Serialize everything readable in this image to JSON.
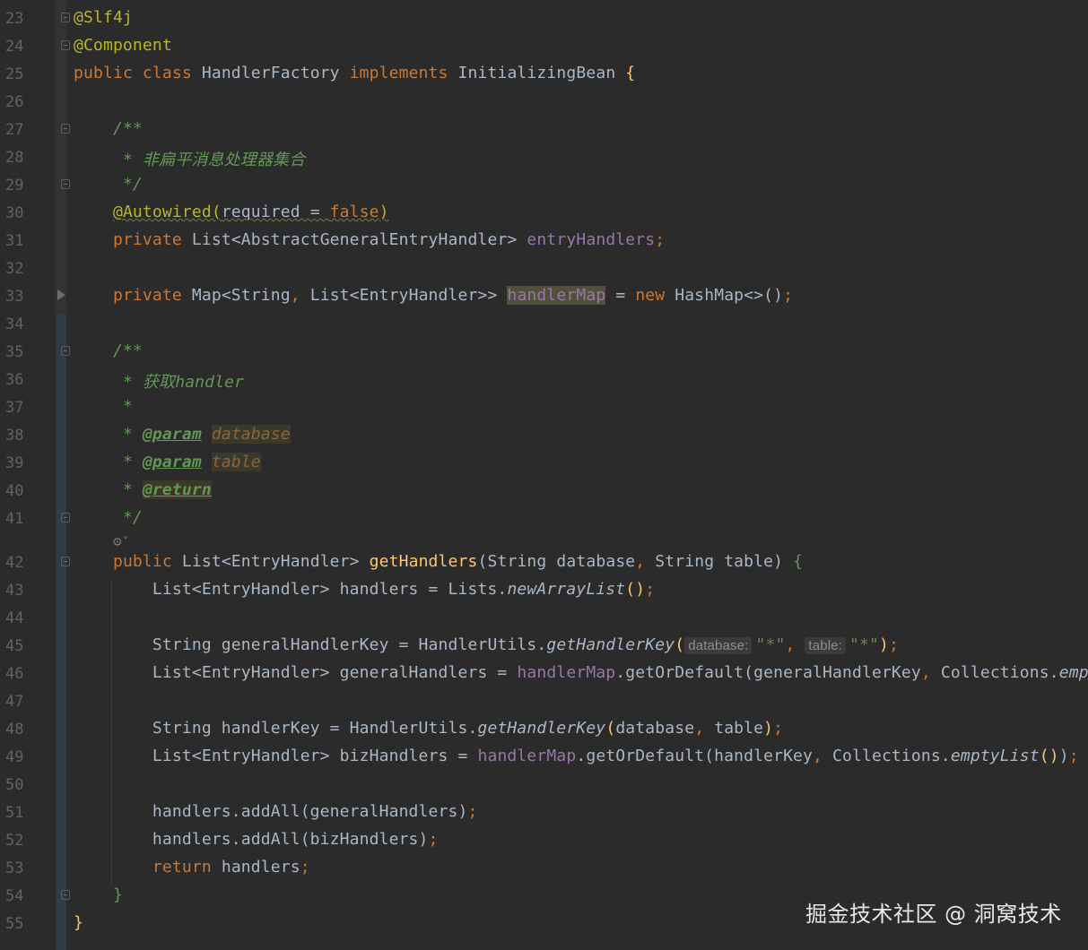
{
  "editor": {
    "language": "Java",
    "colors": {
      "background": "#2b2b2b",
      "keyword": "#cc7832",
      "annotation": "#bbb529",
      "field": "#9876aa",
      "method": "#ffc66d",
      "comment": "#629755",
      "string": "#6a8759",
      "default": "#a9b7c6",
      "line_number": "#606366"
    },
    "lines": [
      {
        "n": "23",
        "tokens": [
          {
            "c": "ann",
            "t": "@Slf4j"
          }
        ]
      },
      {
        "n": "24",
        "tokens": [
          {
            "c": "ann",
            "t": "@Component"
          }
        ]
      },
      {
        "n": "25",
        "tokens": [
          {
            "c": "kw",
            "t": "public class "
          },
          {
            "c": "plain",
            "t": "HandlerFactory "
          },
          {
            "c": "kw",
            "t": "implements "
          },
          {
            "c": "plain",
            "t": "InitializingBean "
          },
          {
            "c": "fn",
            "t": "{"
          }
        ]
      },
      {
        "n": "26",
        "tokens": []
      },
      {
        "n": "27",
        "tokens": [
          {
            "c": "plain",
            "t": "    "
          },
          {
            "c": "cm",
            "t": "/**"
          }
        ]
      },
      {
        "n": "28",
        "tokens": [
          {
            "c": "plain",
            "t": "     "
          },
          {
            "c": "cm",
            "t": "* 非扁平消息处理器集合"
          }
        ]
      },
      {
        "n": "29",
        "tokens": [
          {
            "c": "plain",
            "t": "     "
          },
          {
            "c": "cm",
            "t": "*/"
          }
        ]
      },
      {
        "n": "30",
        "tokens": [
          {
            "c": "plain",
            "t": "    "
          },
          {
            "c": "ann squig",
            "t": "@Autowired("
          },
          {
            "c": "plain squig",
            "t": "required = "
          },
          {
            "c": "kw squig",
            "t": "false"
          },
          {
            "c": "ann squig",
            "t": ")"
          }
        ]
      },
      {
        "n": "31",
        "tokens": [
          {
            "c": "plain",
            "t": "    "
          },
          {
            "c": "kw",
            "t": "private "
          },
          {
            "c": "plain",
            "t": "List<AbstractGeneralEntryHandler> "
          },
          {
            "c": "fld",
            "t": "entryHandlers"
          },
          {
            "c": "kw",
            "t": ";"
          }
        ]
      },
      {
        "n": "32",
        "tokens": []
      },
      {
        "n": "33",
        "tokens": [
          {
            "c": "plain",
            "t": "    "
          },
          {
            "c": "kw",
            "t": "private "
          },
          {
            "c": "plain",
            "t": "Map<String"
          },
          {
            "c": "kw",
            "t": ", "
          },
          {
            "c": "plain",
            "t": "List<EntryHandler>> "
          },
          {
            "c": "fld hl-field",
            "t": "handlerMap"
          },
          {
            "c": "plain",
            "t": " = "
          },
          {
            "c": "kw",
            "t": "new "
          },
          {
            "c": "plain",
            "t": "HashMap<>()"
          },
          {
            "c": "kw",
            "t": ";"
          }
        ]
      },
      {
        "n": "34",
        "tokens": []
      },
      {
        "n": "35",
        "tokens": [
          {
            "c": "plain",
            "t": "    "
          },
          {
            "c": "cm",
            "t": "/**"
          }
        ]
      },
      {
        "n": "36",
        "tokens": [
          {
            "c": "plain",
            "t": "     "
          },
          {
            "c": "cm",
            "t": "* 获取handler"
          }
        ]
      },
      {
        "n": "37",
        "tokens": [
          {
            "c": "plain",
            "t": "     "
          },
          {
            "c": "cm",
            "t": "*"
          }
        ]
      },
      {
        "n": "38",
        "tokens": [
          {
            "c": "plain",
            "t": "     "
          },
          {
            "c": "cm",
            "t": "* "
          },
          {
            "c": "tag",
            "t": "@param"
          },
          {
            "c": "plain",
            "t": " "
          },
          {
            "c": "tagarg hl-param",
            "t": "database"
          }
        ]
      },
      {
        "n": "39",
        "tokens": [
          {
            "c": "plain",
            "t": "     "
          },
          {
            "c": "cm",
            "t": "* "
          },
          {
            "c": "tag",
            "t": "@param"
          },
          {
            "c": "plain",
            "t": " "
          },
          {
            "c": "tagarg hl-param",
            "t": "table"
          }
        ]
      },
      {
        "n": "40",
        "tokens": [
          {
            "c": "plain",
            "t": "     "
          },
          {
            "c": "cm",
            "t": "* "
          },
          {
            "c": "tag hl-param",
            "t": "@return"
          }
        ]
      },
      {
        "n": "41",
        "tokens": [
          {
            "c": "plain",
            "t": "     "
          },
          {
            "c": "cm",
            "t": "*/"
          }
        ]
      },
      {
        "n": "42",
        "tokens": [
          {
            "c": "plain",
            "t": "    "
          },
          {
            "c": "kw",
            "t": "public "
          },
          {
            "c": "plain",
            "t": "List<EntryHandler> "
          },
          {
            "c": "fn",
            "t": "getHandlers"
          },
          {
            "c": "plain",
            "t": "(String database"
          },
          {
            "c": "kw",
            "t": ", "
          },
          {
            "c": "plain",
            "t": "String table) "
          },
          {
            "c": "cmn",
            "t": "{"
          }
        ]
      },
      {
        "n": "43",
        "tokens": [
          {
            "c": "plain",
            "t": "        List<EntryHandler> handlers = Lists."
          },
          {
            "c": "st",
            "t": "newArrayList"
          },
          {
            "c": "fn",
            "t": "()"
          },
          {
            "c": "kw",
            "t": ";"
          }
        ]
      },
      {
        "n": "44",
        "tokens": []
      },
      {
        "n": "45",
        "tokens": [
          {
            "c": "plain",
            "t": "        String generalHandlerKey = HandlerUtils."
          },
          {
            "c": "st",
            "t": "getHandlerKey"
          },
          {
            "c": "fn",
            "t": "("
          },
          {
            "c": "hint",
            "t": "database:"
          },
          {
            "c": "str",
            "t": "\"*\""
          },
          {
            "c": "kw",
            "t": ", "
          },
          {
            "c": "hint",
            "t": "table:"
          },
          {
            "c": "str",
            "t": "\"*\""
          },
          {
            "c": "fn",
            "t": ")"
          },
          {
            "c": "kw",
            "t": ";"
          }
        ]
      },
      {
        "n": "46",
        "tokens": [
          {
            "c": "plain",
            "t": "        List<EntryHandler> generalHandlers = "
          },
          {
            "c": "fld",
            "t": "handlerMap"
          },
          {
            "c": "plain",
            "t": ".getOrDefault(generalHandlerKey"
          },
          {
            "c": "kw",
            "t": ", "
          },
          {
            "c": "plain",
            "t": "Collections."
          },
          {
            "c": "st",
            "t": "empty"
          }
        ]
      },
      {
        "n": "47",
        "tokens": []
      },
      {
        "n": "48",
        "tokens": [
          {
            "c": "plain",
            "t": "        String handlerKey = HandlerUtils."
          },
          {
            "c": "st",
            "t": "getHandlerKey"
          },
          {
            "c": "fn",
            "t": "("
          },
          {
            "c": "plain",
            "t": "database"
          },
          {
            "c": "kw",
            "t": ", "
          },
          {
            "c": "plain",
            "t": "table"
          },
          {
            "c": "fn",
            "t": ")"
          },
          {
            "c": "kw",
            "t": ";"
          }
        ]
      },
      {
        "n": "49",
        "tokens": [
          {
            "c": "plain",
            "t": "        List<EntryHandler> bizHandlers = "
          },
          {
            "c": "fld",
            "t": "handlerMap"
          },
          {
            "c": "plain",
            "t": ".getOrDefault(handlerKey"
          },
          {
            "c": "kw",
            "t": ", "
          },
          {
            "c": "plain",
            "t": "Collections."
          },
          {
            "c": "st",
            "t": "emptyList"
          },
          {
            "c": "fn",
            "t": "()"
          },
          {
            "c": "plain",
            "t": ")"
          },
          {
            "c": "kw",
            "t": ";"
          }
        ]
      },
      {
        "n": "50",
        "tokens": []
      },
      {
        "n": "51",
        "tokens": [
          {
            "c": "plain",
            "t": "        handlers.addAll(generalHandlers)"
          },
          {
            "c": "kw",
            "t": ";"
          }
        ]
      },
      {
        "n": "52",
        "tokens": [
          {
            "c": "plain",
            "t": "        handlers.addAll(bizHandlers)"
          },
          {
            "c": "kw",
            "t": ";"
          }
        ]
      },
      {
        "n": "53",
        "tokens": [
          {
            "c": "plain",
            "t": "        "
          },
          {
            "c": "kw",
            "t": "return "
          },
          {
            "c": "plain",
            "t": "handlers"
          },
          {
            "c": "kw",
            "t": ";"
          }
        ]
      },
      {
        "n": "54",
        "tokens": [
          {
            "c": "plain",
            "t": "    "
          },
          {
            "c": "cmn",
            "t": "}"
          }
        ]
      },
      {
        "n": "55",
        "tokens": [
          {
            "c": "fn",
            "t": "}"
          }
        ]
      }
    ]
  },
  "watermark": "掘金技术社区 @ 洞窝技术"
}
